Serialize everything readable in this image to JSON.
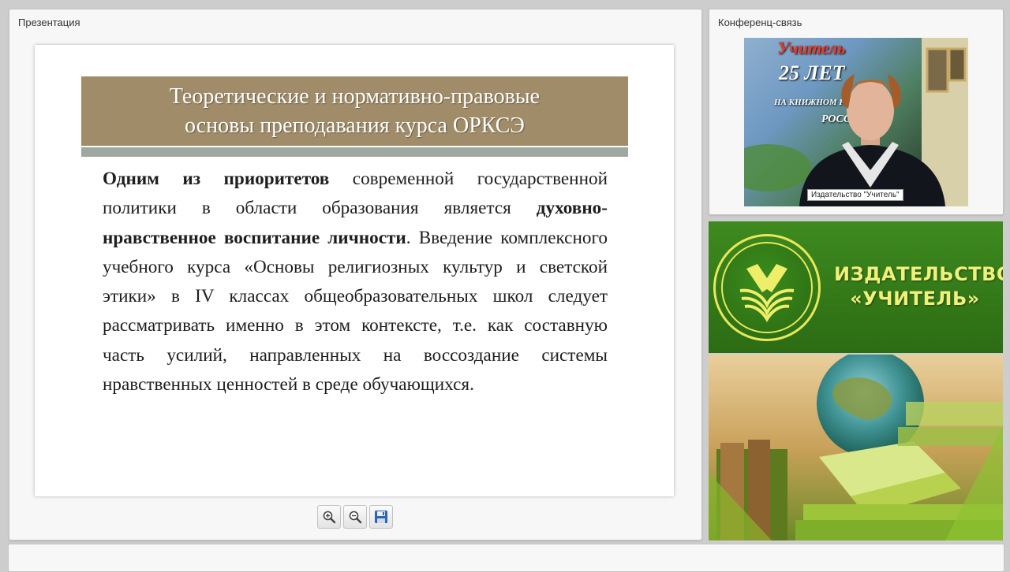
{
  "presentation": {
    "title": "Презентация",
    "slide": {
      "heading": "Теоретические и нормативно-правовые\nосновы преподавания курса ОРКСЭ",
      "body": {
        "b1": "Одним из приоритетов",
        "t1": " современной государственной политики в области образования является ",
        "b2": "духовно-нравственное воспитание личности",
        "t2": ". Введение комплексного учебного курса «Основы религиозных культур и светской этики» в IV классах общеобразовательных школ следует рассматривать именно в этом контексте, т.е. как составную часть усилий, направленных на воссоздание системы нравственных  ценностей в среде обучающихся."
      }
    },
    "toolbar": {
      "zoom_in_icon": "zoom-in-icon",
      "zoom_out_icon": "zoom-out-icon",
      "save_icon": "floppy-disk-icon"
    }
  },
  "conference": {
    "title": "Конференц-связь",
    "video": {
      "participant_label": "Издательство \"Учитель\"",
      "poster_text": {
        "brand": "Учитель",
        "years": "25 ЛЕТ",
        "line1": "НА КНИЖНОМ Р",
        "line2": "РОССИ"
      }
    }
  },
  "publisher_logo": {
    "line1": "ИЗДАТЕЛЬСТВО",
    "line2": "«УЧИТЕЛЬ»"
  },
  "colors": {
    "banner": "#a08c68",
    "banner_bar": "#9fa8a0",
    "logo_bg": "#3e8a1f",
    "logo_text": "#f0f07a"
  }
}
